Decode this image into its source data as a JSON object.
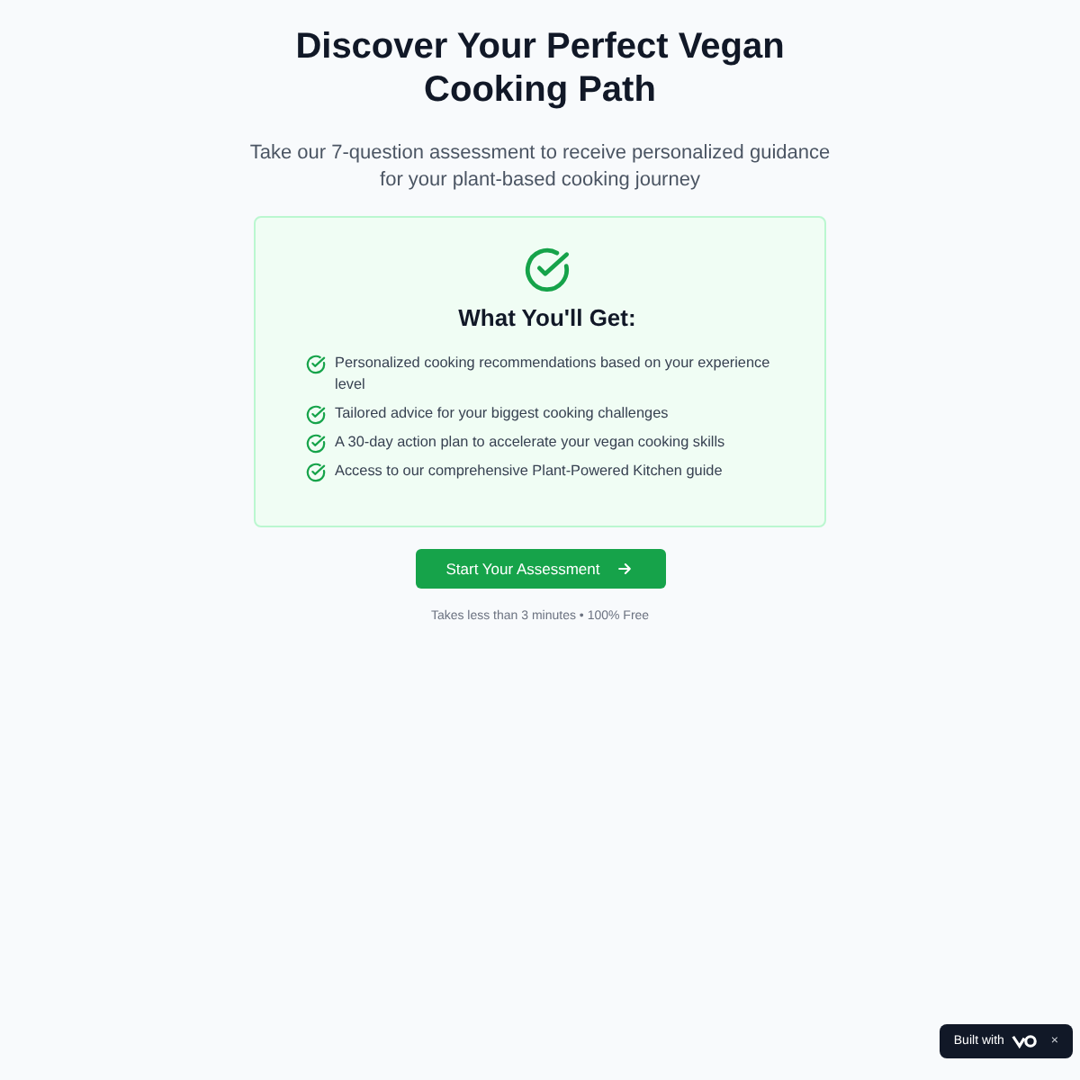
{
  "title": "Discover Your Perfect Vegan Cooking Path",
  "subtitle": "Take our 7-question assessment to receive personalized guidance for your plant-based cooking journey",
  "card": {
    "heading": "What You'll Get:",
    "items": [
      "Personalized cooking recommendations based on your experience level",
      "Tailored advice for your biggest cooking challenges",
      "A 30-day action plan to accelerate your vegan cooking skills",
      "Access to our comprehensive Plant-Powered Kitchen guide"
    ]
  },
  "button": {
    "label": "Start Your Assessment"
  },
  "note": "Takes less than 3 minutes • 100% Free",
  "badge": {
    "label": "Built with",
    "close": "×"
  }
}
